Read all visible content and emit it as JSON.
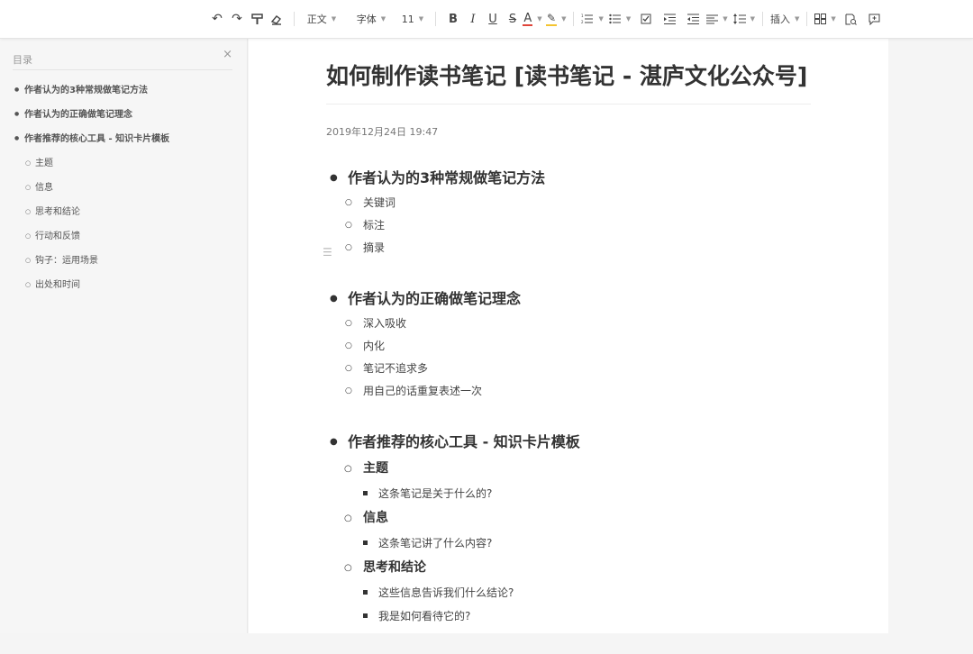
{
  "toolbar": {
    "paragraph_style": "正文",
    "font_family": "字体",
    "font_size": "11",
    "bold": "B",
    "italic": "I",
    "underline": "U",
    "strikethrough": "S",
    "font_color": "A",
    "insert": "插入"
  },
  "sidebar": {
    "title": "目录",
    "close": "×",
    "items": [
      {
        "label": "作者认为的3种常规做笔记方法"
      },
      {
        "label": "作者认为的正确做笔记理念"
      },
      {
        "label": "作者推荐的核心工具 - 知识卡片模板"
      },
      {
        "label": "主题"
      },
      {
        "label": "信息"
      },
      {
        "label": "思考和结论"
      },
      {
        "label": "行动和反馈"
      },
      {
        "label": "钩子：运用场景"
      },
      {
        "label": "出处和时间"
      }
    ]
  },
  "document": {
    "title": "如何制作读书笔记 [读书笔记 - 湛庐文化公众号]",
    "date": "2019年12月24日 19:47",
    "sections": [
      {
        "heading": "作者认为的3种常规做笔记方法",
        "items": [
          "关键词",
          "标注",
          "摘录"
        ]
      },
      {
        "heading": "作者认为的正确做笔记理念",
        "items": [
          "深入吸收",
          "内化",
          "笔记不追求多",
          "用自己的话重复表述一次"
        ]
      },
      {
        "heading": "作者推荐的核心工具 - 知识卡片模板",
        "subsections": [
          {
            "heading": "主题",
            "items": [
              "这条笔记是关于什么的?"
            ]
          },
          {
            "heading": "信息",
            "items": [
              "这条笔记讲了什么内容?"
            ]
          },
          {
            "heading": "思考和结论",
            "items": [
              "这些信息告诉我们什么结论?",
              "我是如何看待它的?"
            ]
          }
        ]
      }
    ]
  },
  "colors": {
    "font_color_bar": "#e0453a",
    "highlight_bar": "#f4c430"
  }
}
